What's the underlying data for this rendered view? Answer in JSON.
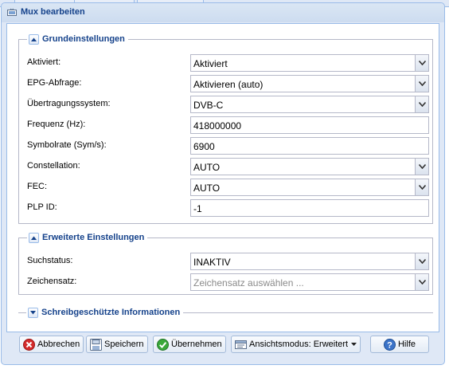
{
  "window": {
    "title": "Mux bearbeiten"
  },
  "background_tabs": [
    {
      "label": ""
    },
    {
      "label": ""
    },
    {
      "label": ""
    }
  ],
  "sections": {
    "basic": {
      "legend": "Grundeinstellungen",
      "fields": [
        {
          "label": "Aktiviert:",
          "value": "Aktiviert",
          "type": "combo"
        },
        {
          "label": "EPG-Abfrage:",
          "value": "Aktivieren (auto)",
          "type": "combo"
        },
        {
          "label": "Übertragungssystem:",
          "value": "DVB-C",
          "type": "combo"
        },
        {
          "label": "Frequenz (Hz):",
          "value": "418000000",
          "type": "text"
        },
        {
          "label": "Symbolrate (Sym/s):",
          "value": "6900",
          "type": "text"
        },
        {
          "label": "Constellation:",
          "value": "AUTO",
          "type": "combo"
        },
        {
          "label": "FEC:",
          "value": "AUTO",
          "type": "combo"
        },
        {
          "label": "PLP ID:",
          "value": "-1",
          "type": "text"
        }
      ]
    },
    "advanced": {
      "legend": "Erweiterte Einstellungen",
      "fields": [
        {
          "label": "Suchstatus:",
          "value": "INAKTIV",
          "type": "combo"
        },
        {
          "label": "Zeichensatz:",
          "placeholder": "Zeichensatz auswählen ...",
          "type": "combo"
        }
      ]
    },
    "readonly": {
      "legend": "Schreibgeschützte Informationen"
    }
  },
  "buttons": {
    "cancel": "Abbrechen",
    "save": "Speichern",
    "apply": "Übernehmen",
    "view_mode": "Ansichtsmodus: Erweitert",
    "help": "Hilfe"
  },
  "colors": {
    "title_text": "#15428b",
    "window_border": "#99bbe8",
    "field_border": "#b5b8c8",
    "cancel_icon": "#d42b2b",
    "apply_icon": "#3aa83a",
    "help_icon": "#3b73c8"
  },
  "icons": {
    "window": "mux-icon",
    "collapse": "chevron-up-icon",
    "expand": "chevron-down-icon",
    "combo": "dropdown-arrow-icon",
    "cancel": "cancel-icon",
    "save": "save-icon",
    "apply": "checkmark-icon",
    "view_mode": "view-mode-icon",
    "help": "help-icon"
  }
}
